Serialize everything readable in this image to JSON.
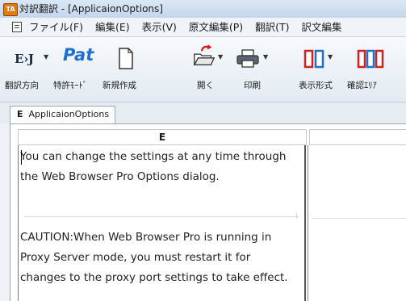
{
  "window": {
    "title": "対訳翻訳 - [ApplicaionOptions]",
    "app_icon_text": "TA"
  },
  "menu": {
    "items": [
      {
        "label": "ファイル(F)"
      },
      {
        "label": "編集(E)"
      },
      {
        "label": "表示(V)"
      },
      {
        "label": "原文編集(P)"
      },
      {
        "label": "翻訳(T)"
      },
      {
        "label": "訳文編集"
      }
    ]
  },
  "toolbar": {
    "direction": {
      "icon_text": "E›J",
      "label": "翻訳方向"
    },
    "patent": {
      "icon_text": "Pat",
      "label": "特許ﾓｰﾄﾞ"
    },
    "new": {
      "label": "新規作成"
    },
    "open": {
      "label": "開く"
    },
    "print": {
      "label": "印刷"
    },
    "display": {
      "label": "表示形式"
    },
    "confirm": {
      "label": "確認ｴﾘｱ"
    }
  },
  "tab": {
    "marker": "E",
    "label": "ApplicaionOptions"
  },
  "editor": {
    "source_header": "E",
    "paragraphs": [
      "You can change the settings at any time through the Web Browser Pro Options dialog.",
      "CAUTION:When Web Browser Pro is running in Proxy Server mode, you must restart it for changes to the proxy port settings to take effect."
    ]
  },
  "colors": {
    "titlebar": "#c4d6ec",
    "menubar": "#f0f3f8",
    "toolbar": "#e3eaf3",
    "accent_red": "#cc2222",
    "accent_blue": "#1e6fd0"
  }
}
